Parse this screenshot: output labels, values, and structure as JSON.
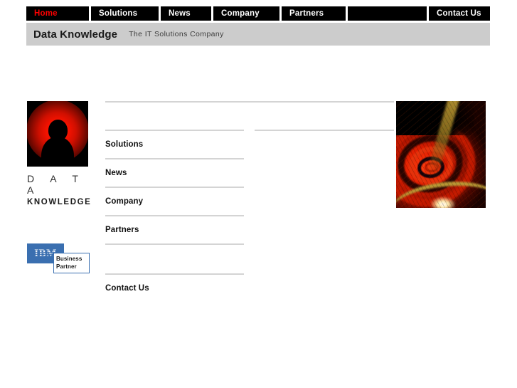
{
  "nav": {
    "items": [
      {
        "label": "Home",
        "active": true,
        "blank": false
      },
      {
        "label": "Solutions",
        "active": false,
        "blank": false
      },
      {
        "label": "News",
        "active": false,
        "blank": false
      },
      {
        "label": "Company",
        "active": false,
        "blank": false
      },
      {
        "label": "Partners",
        "active": false,
        "blank": false
      },
      {
        "label": "",
        "active": false,
        "blank": true
      },
      {
        "label": "Contact Us",
        "active": false,
        "blank": false
      }
    ],
    "active_color": "#ff0000",
    "background_color": "#000000"
  },
  "header": {
    "title": "Data Knowledge",
    "tagline": "The IT Solutions Company",
    "band_color": "#cccccc"
  },
  "logo": {
    "word_top": "D A T A",
    "word_bottom": "KNOWLEDGE",
    "mark_icon": "person-silhouette-glow-icon",
    "glow_color": "#ff1a00",
    "mark_background": "#000000"
  },
  "partner_badge": {
    "brand": "IBM",
    "line1": "Business",
    "line2": "Partner",
    "color": "#3a6fb0"
  },
  "main_links": [
    {
      "label": "Solutions"
    },
    {
      "label": "News"
    },
    {
      "label": "Company"
    },
    {
      "label": "Partners"
    },
    {
      "label": "Contact Us"
    }
  ],
  "artwork": {
    "alt": "red-fractal-spiral-image",
    "dominant_color": "#d32500",
    "accent_color": "#c8a63a"
  },
  "rules": {
    "color": "#d4d4d4"
  }
}
